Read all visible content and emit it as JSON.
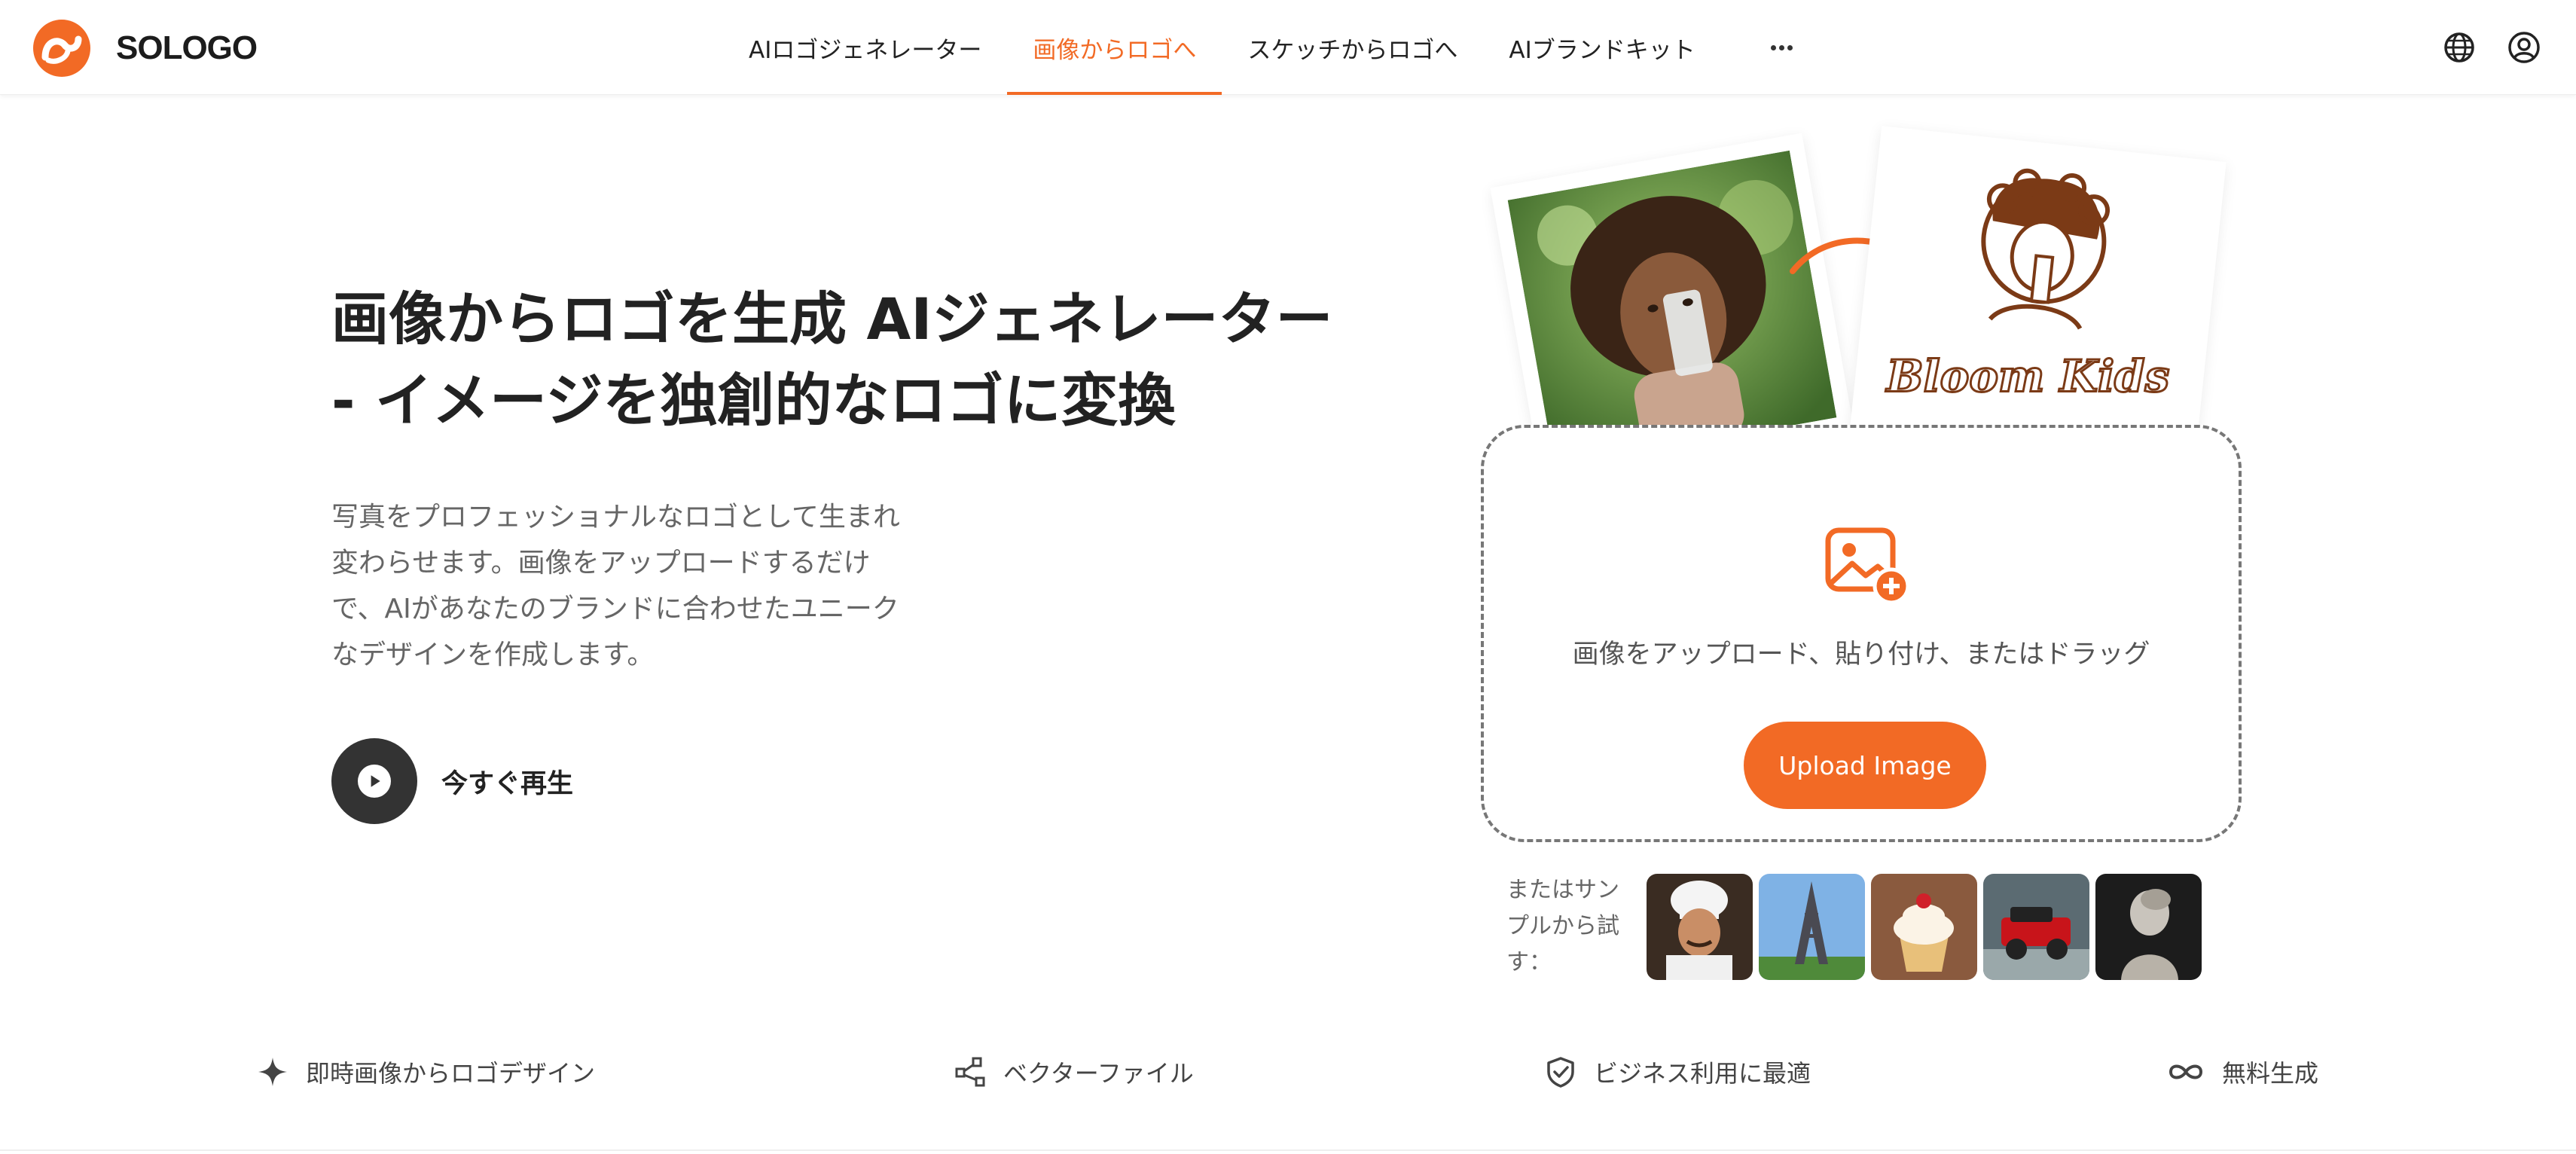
{
  "brand": {
    "name": "SOLOGO",
    "accent_color": "#f26a25",
    "icon": "sologo-logo-icon"
  },
  "nav": {
    "items": [
      {
        "label": "AIロゴジェネレーター",
        "active": false
      },
      {
        "label": "画像からロゴへ",
        "active": true
      },
      {
        "label": "スケッチからロゴへ",
        "active": false
      },
      {
        "label": "AIブランドキット",
        "active": false
      }
    ],
    "more_icon": "ellipsis-icon",
    "language_icon": "globe-icon",
    "account_icon": "user-icon"
  },
  "hero": {
    "title_line1": "画像からロゴを生成 AIジェネレーター",
    "title_line2": "- イメージを独創的なロゴに変換",
    "description": "写真をプロフェッショナルなロゴとして生まれ変わらせます。画像をアップロードするだけで、AIがあなたのブランドに合わせたユニークなデザインを作成します。",
    "play_label": "今すぐ再生",
    "example_logo_text": "Bloom Kids"
  },
  "upload": {
    "instruction": "画像をアップロード、貼り付け、またはドラッグ",
    "button_label": "Upload Image",
    "icon": "image-add-icon"
  },
  "samples": {
    "label": "またはサンプルから試す：",
    "items": [
      {
        "name": "chef"
      },
      {
        "name": "eiffel-tower"
      },
      {
        "name": "cupcake"
      },
      {
        "name": "jeep"
      },
      {
        "name": "statue"
      }
    ]
  },
  "features": [
    {
      "label": "即時画像からロゴデザイン",
      "icon": "sparkle-icon"
    },
    {
      "label": "ベクターファイル",
      "icon": "vector-nodes-icon"
    },
    {
      "label": "ビジネス利用に最適",
      "icon": "shield-check-icon"
    },
    {
      "label": "無料生成",
      "icon": "infinity-icon"
    }
  ]
}
